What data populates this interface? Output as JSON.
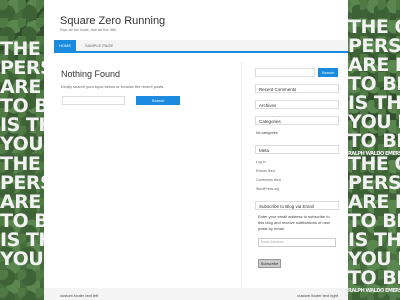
{
  "background": {
    "quote_lines": [
      "THE ONLY",
      "PERSON YOU",
      "ARE DESTINED",
      "TO BECOME",
      "IS THE PERSON",
      "YOU DECIDE",
      "TO BE"
    ],
    "attribution": "RALPH WALDO EMERSON"
  },
  "site": {
    "title": "Square Zero Running",
    "description": "Run all the trails, live all the life!"
  },
  "nav": {
    "home": "HOME",
    "sample": "SAMPLE PAGE"
  },
  "main": {
    "heading": "Nothing Found",
    "message": "Kindly search your topic below or browse the recent posts.",
    "search_placeholder": "",
    "search_button": "Search"
  },
  "sidebar": {
    "search_button": "Search",
    "recent_comments_title": "Recent Comments",
    "archives_title": "Archives",
    "categories_title": "Categories",
    "categories_empty": "No categories",
    "meta_title": "Meta",
    "meta_links": [
      "Log in",
      "Entries feed",
      "Comments feed",
      "WordPress.org"
    ],
    "subscribe_title": "Subscribe to Blog via Email",
    "subscribe_desc": "Enter your email address to subscribe to this blog and receive notifications of new posts by email.",
    "email_placeholder": "Email Address",
    "subscribe_button": "Subscribe"
  },
  "footer": {
    "left": "custom footer text left",
    "right": "custom footer text right"
  },
  "colors": {
    "accent": "#1b8be0"
  }
}
